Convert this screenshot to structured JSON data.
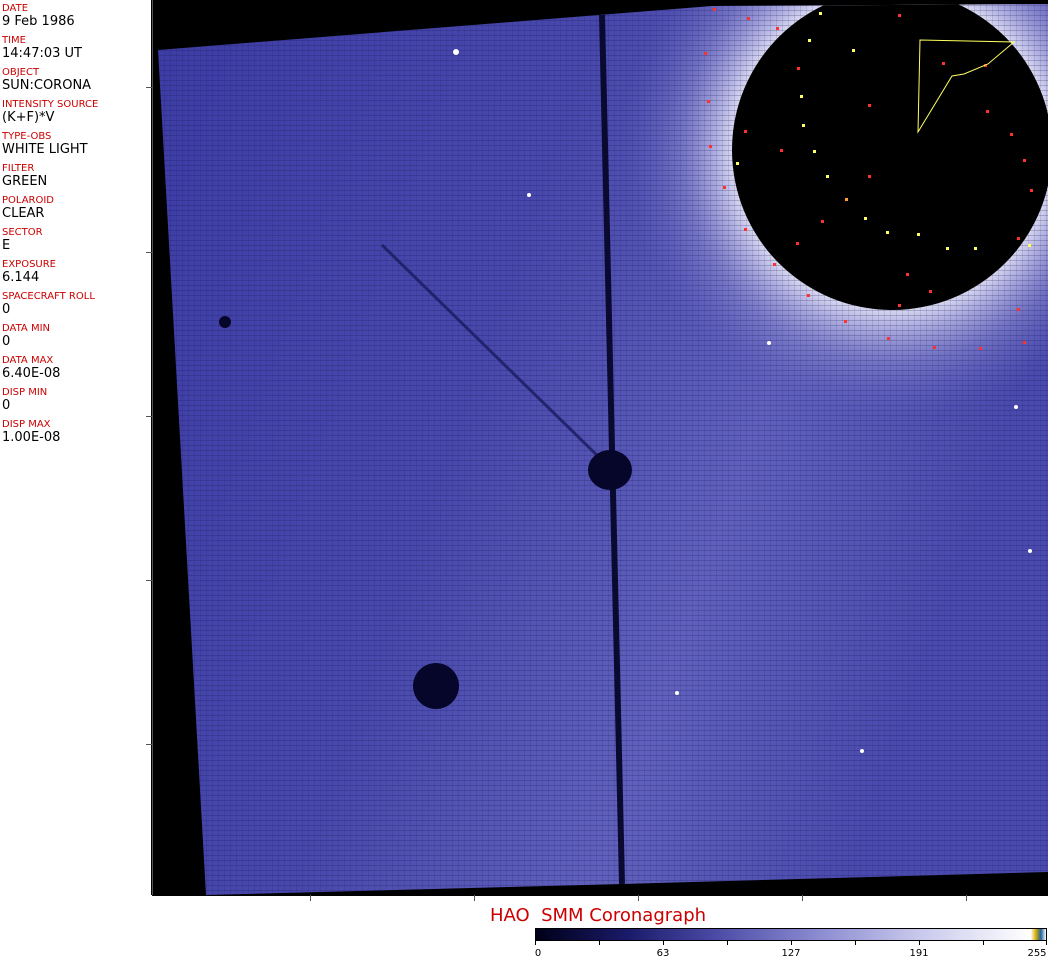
{
  "header_fields": [
    {
      "label": "DATE",
      "value": "9 Feb 1986"
    },
    {
      "label": "TIME",
      "value": "14:47:03 UT"
    },
    {
      "label": "OBJECT",
      "value": "SUN:CORONA"
    },
    {
      "label": "INTENSITY SOURCE",
      "value": "(K+F)*V"
    },
    {
      "label": "TYPE-OBS",
      "value": "WHITE LIGHT"
    },
    {
      "label": "FILTER",
      "value": "GREEN"
    },
    {
      "label": "POLAROID",
      "value": "CLEAR"
    },
    {
      "label": "SECTOR",
      "value": "E"
    },
    {
      "label": "EXPOSURE",
      "value": "6.144"
    },
    {
      "label": "SPACECRAFT ROLL",
      "value": "0"
    },
    {
      "label": "DATA MIN",
      "value": "0"
    },
    {
      "label": "DATA MAX",
      "value": "6.40E-08"
    },
    {
      "label": "DISP MIN",
      "value": "0"
    },
    {
      "label": "DISP MAX",
      "value": "1.00E-08"
    }
  ],
  "caption": "HAO  SMM Coronagraph",
  "colorbar": {
    "labels": [
      "0",
      "63",
      "127",
      "191",
      "255"
    ],
    "colors": {
      "low": "#000018",
      "mid": "#4a4aa6",
      "high": "#ffffff"
    }
  },
  "colors": {
    "label_red": "#cc0000",
    "field_blue": "#3a3a9a",
    "background": "#000000"
  }
}
